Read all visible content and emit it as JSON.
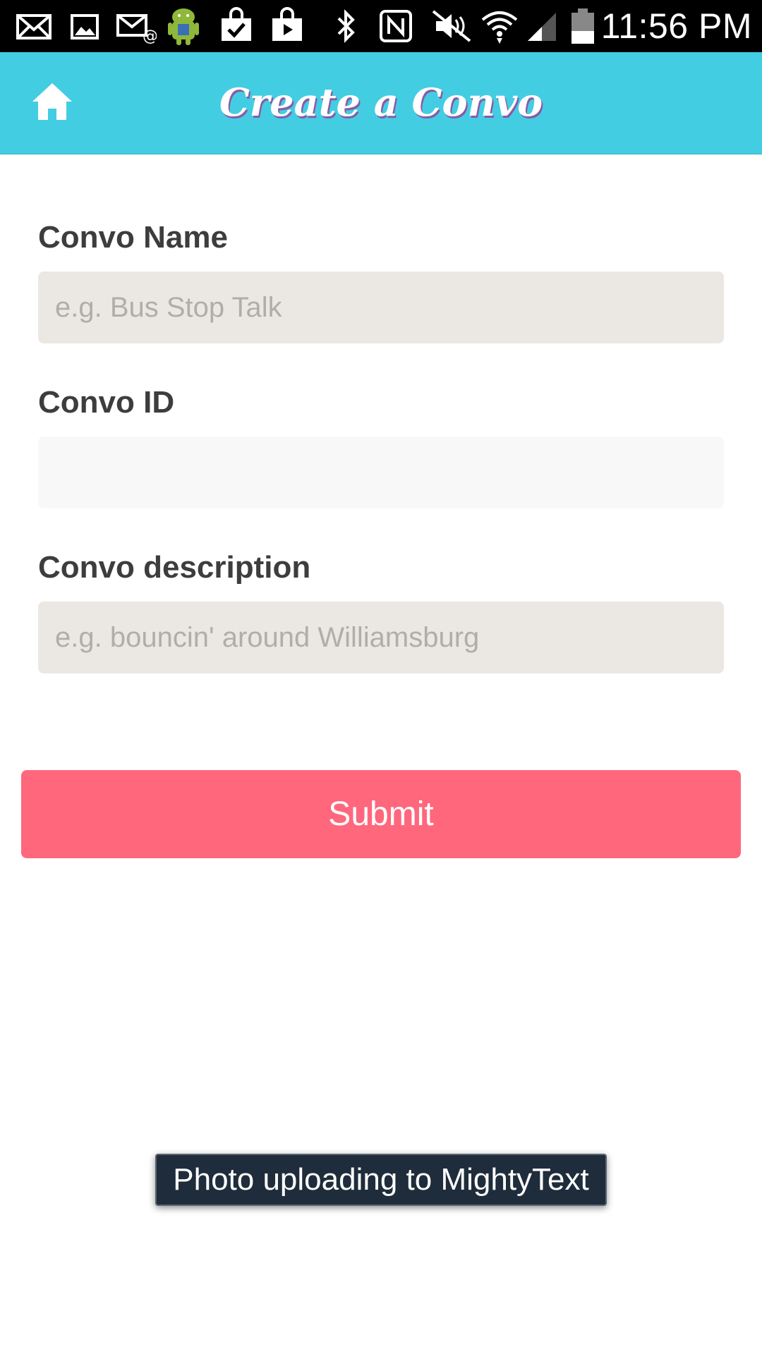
{
  "status_bar": {
    "time": "11:56 PM",
    "icons": [
      "mail-icon",
      "image-icon",
      "email-at-icon",
      "android-icon",
      "shopping-bag-check-icon",
      "play-store-icon",
      "bluetooth-icon",
      "nfc-icon",
      "mute-icon",
      "wifi-icon",
      "signal-icon",
      "battery-icon"
    ]
  },
  "header": {
    "title": "Create a Convo",
    "home_icon": "home-icon",
    "background_color": "#43cde3"
  },
  "form": {
    "name": {
      "label": "Convo Name",
      "placeholder": "e.g. Bus Stop Talk",
      "value": ""
    },
    "id": {
      "label": "Convo ID",
      "placeholder": "",
      "value": ""
    },
    "description": {
      "label": "Convo description",
      "placeholder": "e.g. bouncin' around Williamsburg",
      "value": ""
    },
    "submit_label": "Submit",
    "submit_color": "#ff677d"
  },
  "toast": {
    "message": "Photo uploading to MightyText"
  }
}
